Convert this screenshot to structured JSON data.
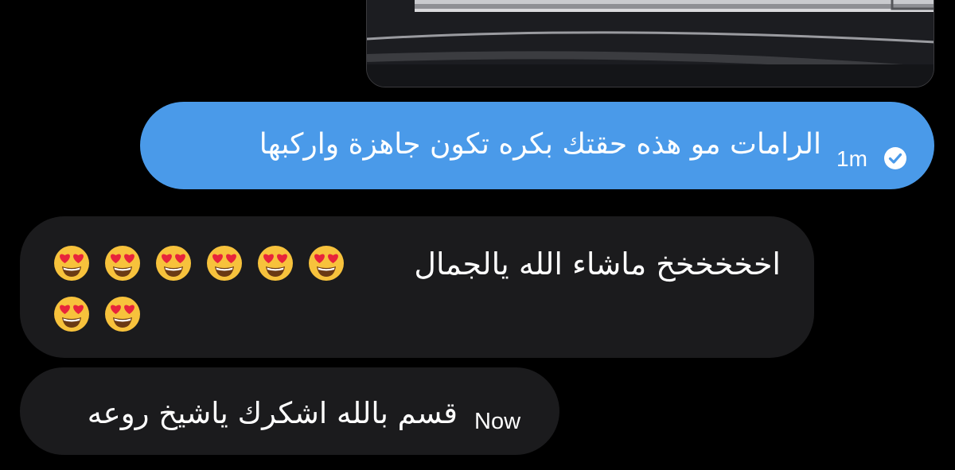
{
  "photo_attachment": {
    "icon": "image-attachment"
  },
  "messages": {
    "outgoing": {
      "text": "الرامات مو هذه حقتك بكره تكون جاهزة واركبها",
      "time": "1m",
      "status_icon": "read-check-icon",
      "bubble_color": "#4a9ae9"
    },
    "incoming_1": {
      "text": "اخخخخخخ ماشاء الله يالجمال",
      "emoji": "😍",
      "emoji_count": 8,
      "bubble_color": "#1b1b1d"
    },
    "incoming_2": {
      "text": "قسم بالله اشكرك ياشيخ روعه",
      "time": "Now",
      "bubble_color": "#1b1b1d"
    }
  }
}
